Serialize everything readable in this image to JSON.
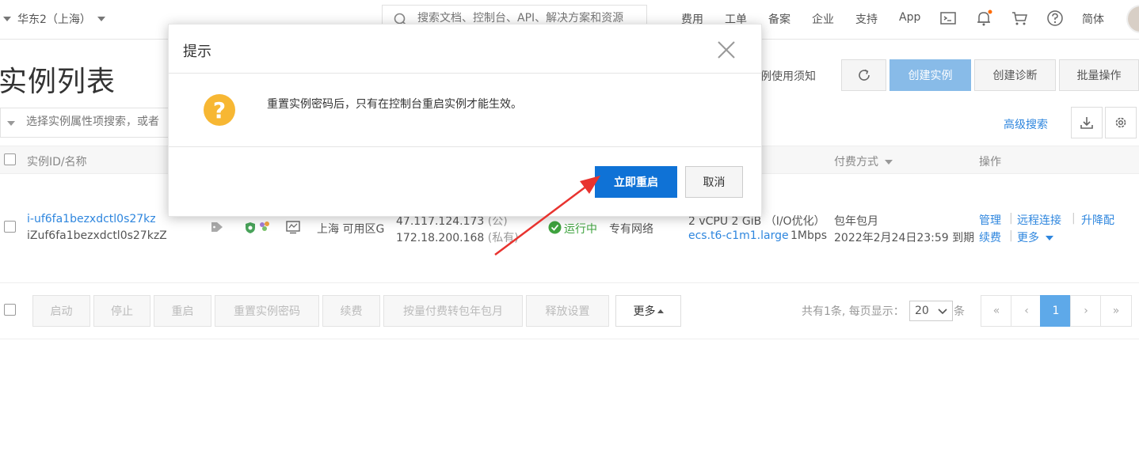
{
  "topbar": {
    "region": "华东2（上海）",
    "search_placeholder": "搜索文档、控制台、API、解决方案和资源",
    "nav": [
      "费用",
      "工单",
      "备案",
      "企业",
      "支持",
      "App"
    ],
    "lang": "简体",
    "icons": [
      "terminal-icon",
      "bell-icon",
      "cart-icon",
      "help-icon"
    ]
  },
  "page": {
    "title": "实例列表",
    "notice_link": "实例使用须知",
    "create_instance": "创建实例",
    "create_diagnosis": "创建诊断",
    "batch_ops": "批量操作",
    "filter_placeholder": "选择实例属性项搜索，或者",
    "advanced_search": "高级搜索"
  },
  "table": {
    "headers": {
      "id_name": "实例ID/名称",
      "billing": "付费方式",
      "actions": "操作"
    },
    "row": {
      "instance_id": "i-uf6fa1bezxdctl0s27kz",
      "instance_name": "iZuf6fa1bezxdctl0s27kzZ",
      "zone": "上海 可用区G",
      "public_ip": "47.117.124.173",
      "public_tag": "(公)",
      "private_ip": "172.18.200.168",
      "private_tag": "(私有)",
      "status": "运行中",
      "network": "专有网络",
      "spec": "2 vCPU 2 GiB （I/O优化）",
      "spec_type": "ecs.t6-c1m1.large",
      "bandwidth": "1Mbps",
      "billing": "包年包月",
      "expiry": "2022年2月24日23:59 到期",
      "actions": [
        "管理",
        "远程连接",
        "升降配",
        "续费",
        "更多"
      ]
    }
  },
  "bulk_actions": [
    "启动",
    "停止",
    "重启",
    "重置实例密码",
    "续费",
    "按量付费转包年包月",
    "释放设置",
    "更多"
  ],
  "pagination": {
    "summary": "共有1条, 每页显示：",
    "page_size": "20",
    "unit": "条",
    "first": "«",
    "prev": "‹",
    "current": "1",
    "next": "›",
    "last": "»"
  },
  "modal": {
    "title": "提示",
    "message": "重置实例密码后，只有在控制台重启实例才能生效。",
    "confirm": "立即重启",
    "cancel": "取消"
  },
  "colors": {
    "primary": "#0f72d6",
    "link": "#2e86de",
    "warning": "#f7b733",
    "status_ok": "#3fa33f",
    "arrow": "#e8332f"
  }
}
